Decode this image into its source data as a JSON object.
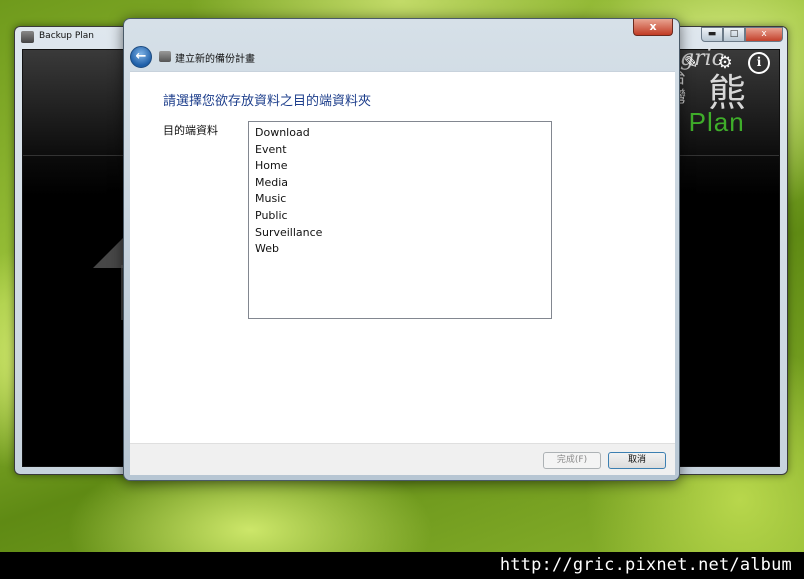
{
  "main_window": {
    "title": "Backup Plan",
    "caption_minimize": "▬",
    "caption_maximize": "□",
    "caption_close": "x",
    "brand_partial": "p Plan",
    "toolbar": {
      "edit_icon": "✎",
      "settings_icon": "⚙",
      "info_icon": "i"
    }
  },
  "watermark": {
    "script": "gric",
    "char_tai": "台灣",
    "char_bear": "熊"
  },
  "dialog": {
    "close_label": "x",
    "back_icon": "←",
    "wizard_title": "建立新的備份計畫",
    "instruction": "請選擇您欲存放資料之目的端資料夾",
    "destination_label": "目的端資料",
    "folders": [
      "Download",
      "Event",
      "Home",
      "Media",
      "Music",
      "Public",
      "Surveillance",
      "Web"
    ],
    "finish_label": "完成(F)",
    "cancel_label": "取消"
  },
  "url_watermark": "http://gric.pixnet.net/album"
}
